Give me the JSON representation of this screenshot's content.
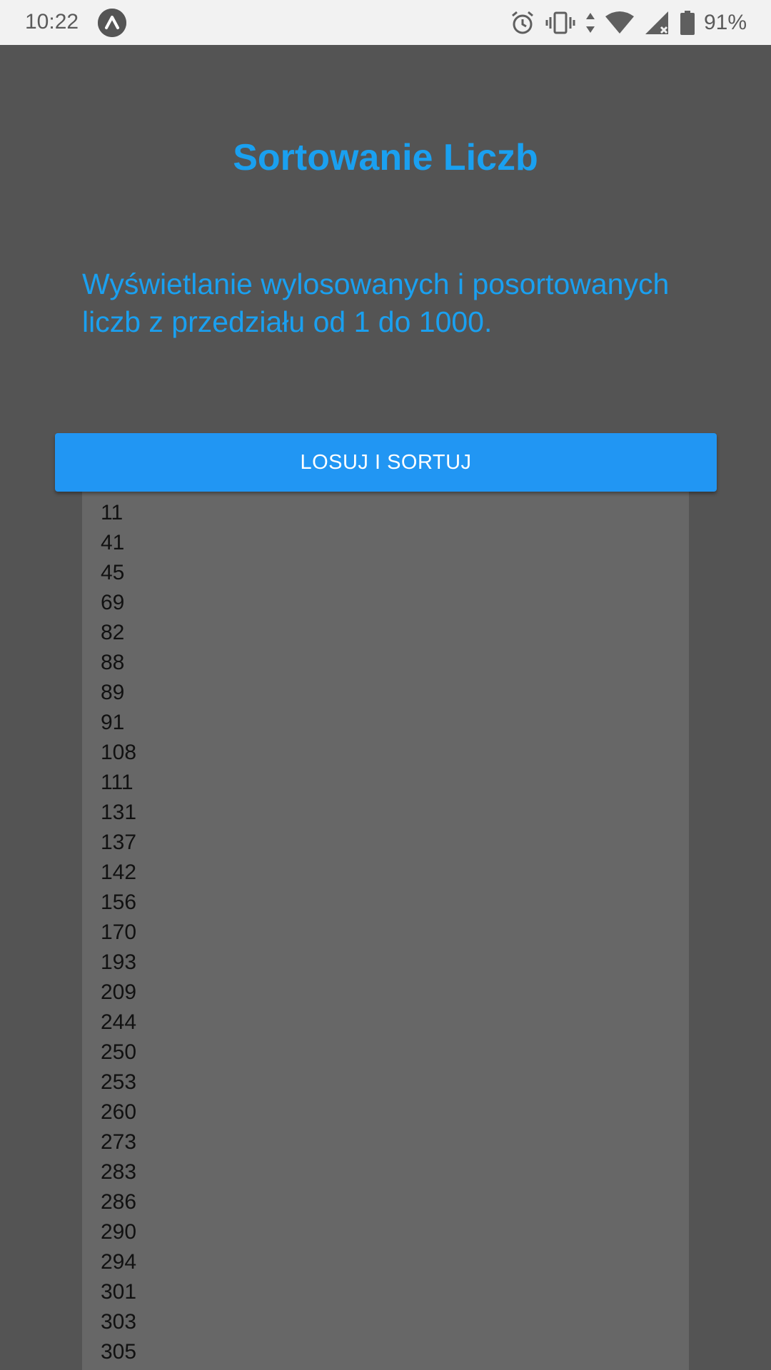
{
  "status_bar": {
    "time": "10:22",
    "battery": "91%",
    "icons": [
      "app-badge-icon",
      "alarm-icon",
      "vibrate-icon",
      "data-arrows-icon",
      "wifi-icon",
      "signal-icon",
      "battery-icon"
    ]
  },
  "app": {
    "title": "Sortowanie Liczb",
    "description": "Wyświetlanie wylosowanych i posortowanych liczb z przedziału od 1 do 1000.",
    "button_label": "LOSUJ I SORTUJ",
    "numbers": [
      "11",
      "41",
      "45",
      "69",
      "82",
      "88",
      "89",
      "91",
      "108",
      "111",
      "131",
      "137",
      "142",
      "156",
      "170",
      "193",
      "209",
      "244",
      "250",
      "253",
      "260",
      "273",
      "283",
      "286",
      "290",
      "294",
      "301",
      "303",
      "305"
    ]
  },
  "colors": {
    "background": "#545454",
    "accent": "#1aa0f0",
    "button": "#2196f3",
    "list_background": "#676767"
  }
}
